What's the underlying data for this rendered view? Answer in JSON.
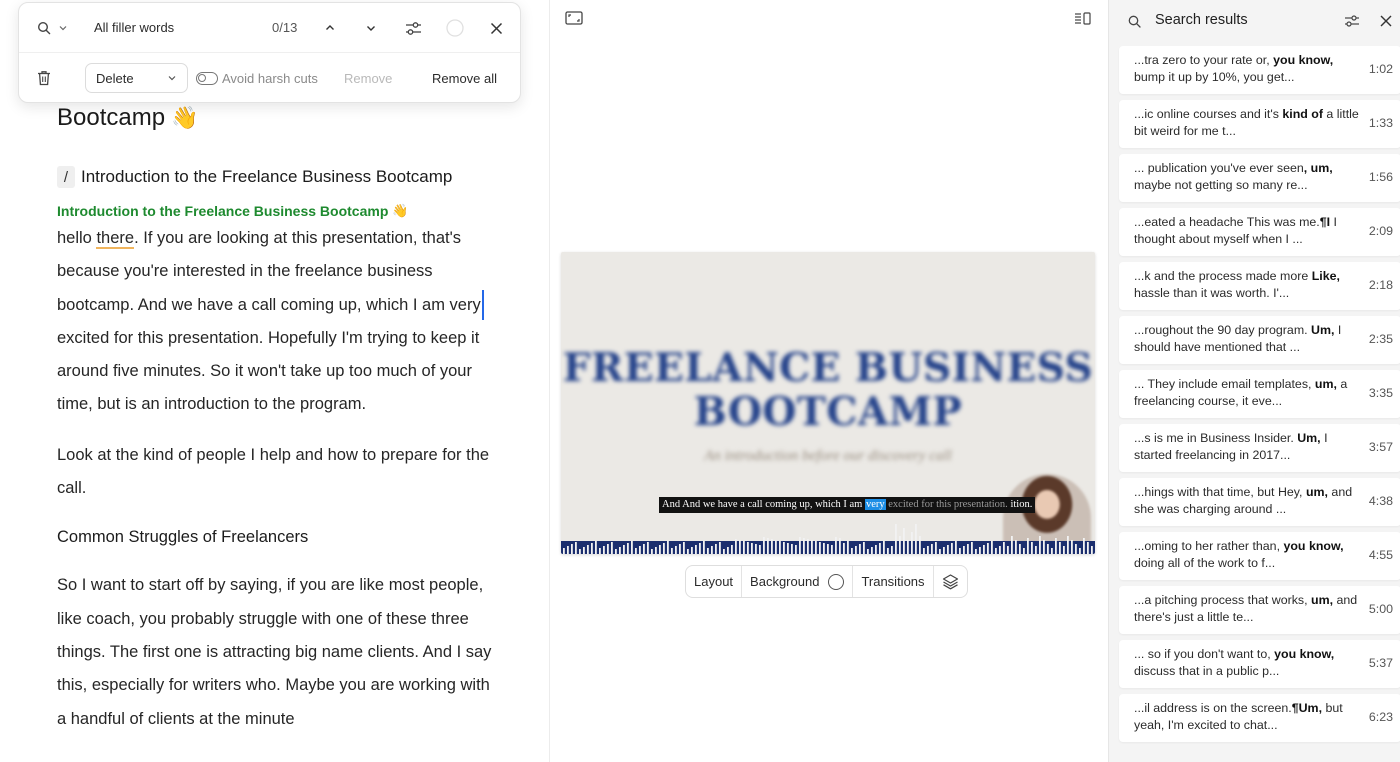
{
  "find_panel": {
    "query": "All filler words",
    "count": "0/13",
    "action_select": "Delete",
    "avoid_harsh_cuts": "Avoid harsh cuts",
    "remove": "Remove",
    "remove_all": "Remove all"
  },
  "document": {
    "title_fragment": "Bootcamp",
    "title_emoji": "👋",
    "scene_slash": "/",
    "scene_heading": "Introduction to the Freelance Business Bootcamp",
    "scene_label": "Introduction to the Freelance Business Bootcamp",
    "scene_label_emoji": "👋",
    "para1": {
      "a": " hello ",
      "underlined": "there",
      "b": ". If you are looking at this presentation, that's because you're interested in the freelance business bootcamp. And we have a call coming up, which I am very",
      "c": "excited for this presentation. Hopefully I'm trying to keep it around five minutes. So it won't take up too much of your time, but is an introduction to the program."
    },
    "para2": "Look at the kind of people I help and how to prepare for the call.",
    "section_heading": "Common Struggles of Freelancers",
    "para3": "So I want to start off by saying, if you are like most people, like coach, you probably struggle with one of these three things. The first one is attracting big name clients. And I say this, especially for writers who. Maybe you are working with a handful of clients at the minute"
  },
  "video": {
    "title_line1": "FREELANCE BUSINESS",
    "title_line2": "BOOTCAMP",
    "subtitle": "An introduction before our discovery call",
    "caption_a": "And ",
    "caption_b": "And we have a call coming up, which I am ",
    "caption_highlight": "very",
    "caption_c": " excited for this presentation.",
    "caption_d": " ition."
  },
  "video_toolbar": {
    "layout": "Layout",
    "background": "Background",
    "transitions": "Transitions"
  },
  "search_results": {
    "title": "Search results",
    "items": [
      {
        "pre": "...tra zero to your rate or, ",
        "match": "you know,",
        "post": " bump it up by 10%, you get...",
        "time": "1:02"
      },
      {
        "pre": "...ic online courses and it's ",
        "match": "kind of",
        "post": " a little bit weird for me t...",
        "time": "1:33"
      },
      {
        "pre": "... publication you've ever seen",
        "match": ", um,",
        "post": " maybe not getting so many re...",
        "time": "1:56"
      },
      {
        "pre": "...eated a headache This was me.",
        "match": "¶I",
        "post": " I thought about myself when I ...",
        "time": "2:09"
      },
      {
        "pre": "...k and the process made more ",
        "match": "Like,",
        "post": " hassle than it was worth. I'...",
        "time": "2:18"
      },
      {
        "pre": "...roughout the 90 day program. ",
        "match": "Um,",
        "post": " I should have mentioned that ...",
        "time": "2:35"
      },
      {
        "pre": "... They include email templates, ",
        "match": "um,",
        "post": " a freelancing course, it eve...",
        "time": "3:35"
      },
      {
        "pre": "...s is me in Business Insider. ",
        "match": "Um,",
        "post": " I started freelancing in 2017...",
        "time": "3:57"
      },
      {
        "pre": "...hings with that time, but Hey, ",
        "match": "um,",
        "post": " and she was charging around ...",
        "time": "4:38"
      },
      {
        "pre": "...oming to her rather than, ",
        "match": "you know,",
        "post": " doing all of the work to f...",
        "time": "4:55"
      },
      {
        "pre": "...a pitching process that works, ",
        "match": "um,",
        "post": " and there's just a little te...",
        "time": "5:00"
      },
      {
        "pre": "... so if you don't want to, ",
        "match": "you know,",
        "post": " discuss that in a public p...",
        "time": "5:37"
      },
      {
        "pre": "...il address is on the screen.",
        "match": "¶Um,",
        "post": " but yeah, I'm excited to chat...",
        "time": "6:23"
      }
    ]
  }
}
